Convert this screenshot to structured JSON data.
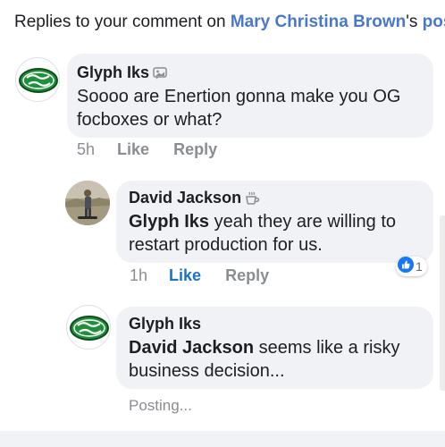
{
  "header": {
    "prefix": "Replies to your comment on ",
    "author": "Mary Christina Brown",
    "possessive": "'s ",
    "post_link": "post"
  },
  "comments": [
    {
      "author": "Glyph Iks",
      "badge_icon": "picture-comment-icon",
      "text": "Soooo are Enertion gonna make you OG focboxes or what?",
      "time": "5h",
      "like": "Like",
      "reply": "Reply"
    },
    {
      "author": "David Jackson",
      "badge_icon": "coffee-icon",
      "mention": "Glyph Iks",
      "text": " yeah they are willing to restart production for us.",
      "time": "1h",
      "like": "Like",
      "reply": "Reply",
      "reaction_count": "1"
    },
    {
      "author": "Glyph Iks",
      "mention": "David Jackson",
      "text": " seems like a risky business decision...",
      "status": "Posting..."
    }
  ],
  "colors": {
    "link": "#4a78c8",
    "like_active": "#1a73c9",
    "bubble": "#f0f2f5",
    "logo_green": "#1e8f3a"
  }
}
